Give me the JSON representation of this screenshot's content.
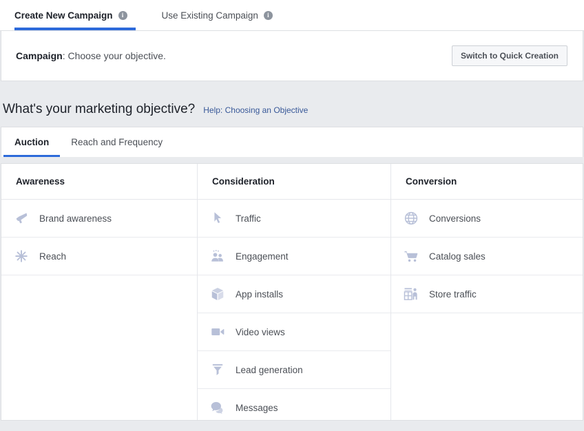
{
  "top_tabs": [
    {
      "label": "Create New Campaign",
      "active": true,
      "info_icon": "info-icon",
      "info_glyph": "i"
    },
    {
      "label": "Use Existing Campaign",
      "active": false,
      "info_icon": "info-icon",
      "info_glyph": "i"
    }
  ],
  "campaign_bar": {
    "label_bold": "Campaign",
    "label_rest": ": Choose your objective.",
    "switch_button": "Switch to Quick Creation"
  },
  "objective_section": {
    "title": "What's your marketing objective?",
    "help_link": "Help: Choosing an Objective"
  },
  "sub_tabs": [
    {
      "label": "Auction",
      "active": true
    },
    {
      "label": "Reach and Frequency",
      "active": false
    }
  ],
  "columns": [
    {
      "header": "Awareness",
      "options": [
        {
          "label": "Brand awareness",
          "icon": "megaphone-icon"
        },
        {
          "label": "Reach",
          "icon": "starburst-icon"
        }
      ]
    },
    {
      "header": "Consideration",
      "options": [
        {
          "label": "Traffic",
          "icon": "cursor-arrow-icon"
        },
        {
          "label": "Engagement",
          "icon": "people-icon"
        },
        {
          "label": "App installs",
          "icon": "cube-box-icon"
        },
        {
          "label": "Video views",
          "icon": "video-camera-icon"
        },
        {
          "label": "Lead generation",
          "icon": "funnel-icon"
        },
        {
          "label": "Messages",
          "icon": "speech-bubbles-icon"
        }
      ]
    },
    {
      "header": "Conversion",
      "options": [
        {
          "label": "Conversions",
          "icon": "globe-icon"
        },
        {
          "label": "Catalog sales",
          "icon": "shopping-cart-icon"
        },
        {
          "label": "Store traffic",
          "icon": "storefront-icon"
        }
      ]
    }
  ],
  "colors": {
    "accent_blue": "#2d6ada",
    "link_blue": "#385898",
    "icon_lavender": "#b8c0d8",
    "page_bg": "#e9ebee",
    "text_dark": "#1d2129",
    "text_muted": "#4b4f56"
  }
}
